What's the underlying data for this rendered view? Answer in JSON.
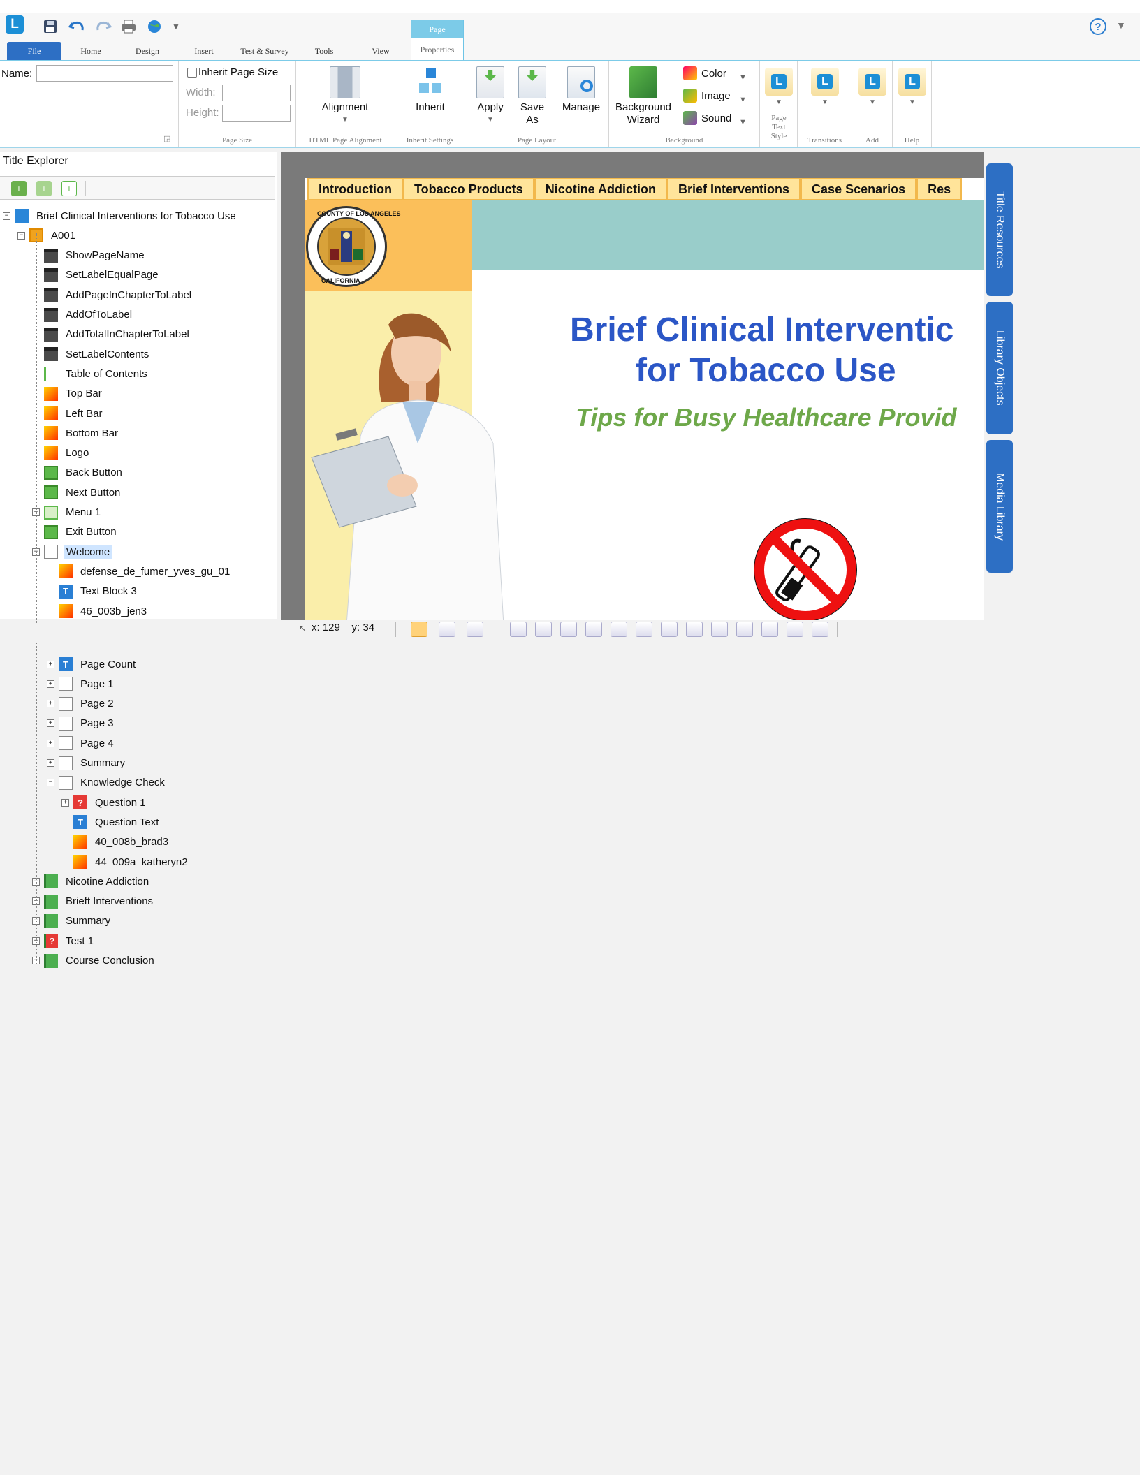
{
  "app": {
    "logo_letter": "L"
  },
  "quick_access": {
    "icons": [
      "save-icon",
      "undo-icon",
      "redo-icon",
      "print-icon",
      "publish-icon",
      "customize-dropdown-icon"
    ]
  },
  "help": {
    "symbol": "?"
  },
  "tabs": [
    {
      "label": "File"
    },
    {
      "label": "Home"
    },
    {
      "label": "Design"
    },
    {
      "label": "Insert"
    },
    {
      "label": "Test & Survey"
    },
    {
      "label": "Tools"
    },
    {
      "label": "View"
    }
  ],
  "context_tab": {
    "group": "Page",
    "label": "Properties"
  },
  "ribbon": {
    "name_label": "Name:",
    "name_value": "",
    "page_size": {
      "inherit_label": "Inherit Page Size",
      "width_label": "Width:",
      "height_label": "Height:",
      "group": "Page Size"
    },
    "html_align": {
      "button": "Alignment",
      "group": "HTML Page Alignment"
    },
    "inherit": {
      "button": "Inherit",
      "group": "Inherit Settings"
    },
    "layout": {
      "apply": "Apply",
      "save_as_1": "Save",
      "save_as_2": "As",
      "manage": "Manage",
      "group": "Page Layout"
    },
    "background": {
      "wizard_1": "Background",
      "wizard_2": "Wizard",
      "color": "Color",
      "image": "Image",
      "sound": "Sound",
      "group": "Background"
    },
    "page_text_style": {
      "line1": "Page",
      "line2": "Text",
      "line3": "Style"
    },
    "transitions": {
      "group": "Transitions"
    },
    "add": {
      "group": "Add"
    },
    "help": {
      "group": "Help"
    },
    "L": "L"
  },
  "explorer": {
    "title": "Title Explorer",
    "tree": [
      {
        "label": "Brief Clinical Interventions for Tobacco Use",
        "icon": "book",
        "level": 0,
        "exp": "-"
      },
      {
        "label": "A001",
        "icon": "chapter",
        "level": 1,
        "exp": "-"
      },
      {
        "label": "ShowPageName",
        "icon": "script",
        "level": 2
      },
      {
        "label": "SetLabelEqualPage",
        "icon": "script",
        "level": 2
      },
      {
        "label": "AddPageInChapterToLabel",
        "icon": "script",
        "level": 2
      },
      {
        "label": "AddOfToLabel",
        "icon": "script",
        "level": 2
      },
      {
        "label": "AddTotalInChapterToLabel",
        "icon": "script",
        "level": 2
      },
      {
        "label": "SetLabelContents",
        "icon": "script",
        "level": 2
      },
      {
        "label": "Table of Contents",
        "icon": "toc",
        "level": 2
      },
      {
        "label": "Top Bar",
        "icon": "image",
        "level": 2
      },
      {
        "label": "Left Bar",
        "icon": "image",
        "level": 2
      },
      {
        "label": "Bottom Bar",
        "icon": "image",
        "level": 2
      },
      {
        "label": "Logo",
        "icon": "image",
        "level": 2
      },
      {
        "label": "Back Button",
        "icon": "button",
        "level": 2
      },
      {
        "label": "Next Button",
        "icon": "button",
        "level": 2
      },
      {
        "label": "Menu 1",
        "icon": "menu",
        "level": 2,
        "exp": "+"
      },
      {
        "label": "Exit Button",
        "icon": "button",
        "level": 2
      },
      {
        "label": "Welcome",
        "icon": "page",
        "level": 2,
        "exp": "-",
        "selected": true
      },
      {
        "label": "defense_de_fumer_yves_gu_01",
        "icon": "image",
        "level": 3
      },
      {
        "label": "Text Block 3",
        "icon": "text",
        "level": 3
      },
      {
        "label": "46_003b_jen3",
        "icon": "image",
        "level": 3
      }
    ],
    "lower_tree": [
      {
        "label": "Page Count",
        "icon": "text",
        "level": 3,
        "exp": "+"
      },
      {
        "label": "Page 1",
        "icon": "page",
        "level": 3,
        "exp": "+"
      },
      {
        "label": "Page 2",
        "icon": "page",
        "level": 3,
        "exp": "+"
      },
      {
        "label": "Page 3",
        "icon": "page",
        "level": 3,
        "exp": "+"
      },
      {
        "label": "Page 4",
        "icon": "page",
        "level": 3,
        "exp": "+"
      },
      {
        "label": "Summary",
        "icon": "page",
        "level": 3,
        "exp": "+"
      },
      {
        "label": "Knowledge Check",
        "icon": "page",
        "level": 3,
        "exp": "-"
      },
      {
        "label": "Question 1",
        "icon": "question",
        "level": 4,
        "exp": "+"
      },
      {
        "label": "Question Text",
        "icon": "text",
        "level": 4
      },
      {
        "label": "40_008b_brad3",
        "icon": "image",
        "level": 4
      },
      {
        "label": "44_009a_katheryn2",
        "icon": "image",
        "level": 4
      },
      {
        "label": "Nicotine Addiction",
        "icon": "greenbook",
        "level": 2,
        "exp": "+"
      },
      {
        "label": "Brieft Interventions",
        "icon": "greenbook",
        "level": 2,
        "exp": "+"
      },
      {
        "label": "Summary",
        "icon": "greenbook",
        "level": 2,
        "exp": "+"
      },
      {
        "label": "Test 1",
        "icon": "test",
        "level": 2,
        "exp": "+"
      },
      {
        "label": "Course Conclusion",
        "icon": "greenbook",
        "level": 2,
        "exp": "+"
      }
    ]
  },
  "page": {
    "nav": [
      "Introduction",
      "Tobacco Products",
      "Nicotine Addiction",
      "Brief Interventions",
      "Case Scenarios",
      "Res"
    ],
    "seal_top": "COUNTY OF LOS ANGELES",
    "seal_bottom": "CALIFORNIA",
    "title_line1": "Brief Clinical Interventic",
    "title_line2": "for Tobacco Use",
    "subtitle": "Tips for Busy Healthcare Provid",
    "colors": {
      "title": "#2b56c6",
      "subtitle": "#6ea84a",
      "nav_bg": "#ffe49a",
      "teal": "#99cdca",
      "orange": "#fbbf5a"
    }
  },
  "side_tabs": [
    "Title Resources",
    "Library Objects",
    "Media Library"
  ],
  "status": {
    "x_label": "x: 129",
    "y_label": "y: 34"
  }
}
